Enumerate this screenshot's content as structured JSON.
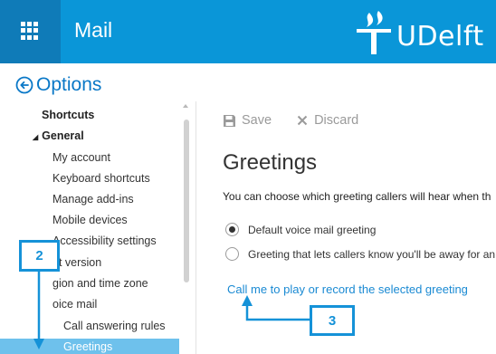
{
  "topbar": {
    "app_title": "Mail",
    "logo_text": "UDelft",
    "colors": {
      "bar": "#0a96d8",
      "app_tile": "#0f7bb8"
    }
  },
  "options": {
    "label": "Options"
  },
  "nav": {
    "shortcuts": "Shortcuts",
    "general": "General",
    "items": [
      "My account",
      "Keyboard shortcuts",
      "Manage add-ins",
      "Mobile devices",
      "Accessibility settings",
      "ht version",
      "gion and time zone",
      "oice mail",
      "Call answering rules",
      "Greetings"
    ],
    "selected": "Greetings"
  },
  "toolbar": {
    "save_label": "Save",
    "discard_label": "Discard"
  },
  "main": {
    "title": "Greetings",
    "description": "You can choose which greeting callers will hear when th",
    "options": [
      {
        "label": "Default voice mail greeting",
        "checked": true
      },
      {
        "label": "Greeting that lets callers know you'll be away for an",
        "checked": false
      }
    ],
    "link": "Call me to play or record the selected greeting"
  },
  "annotations": {
    "step_a": "2",
    "step_b": "3",
    "color": "#1592d8"
  }
}
